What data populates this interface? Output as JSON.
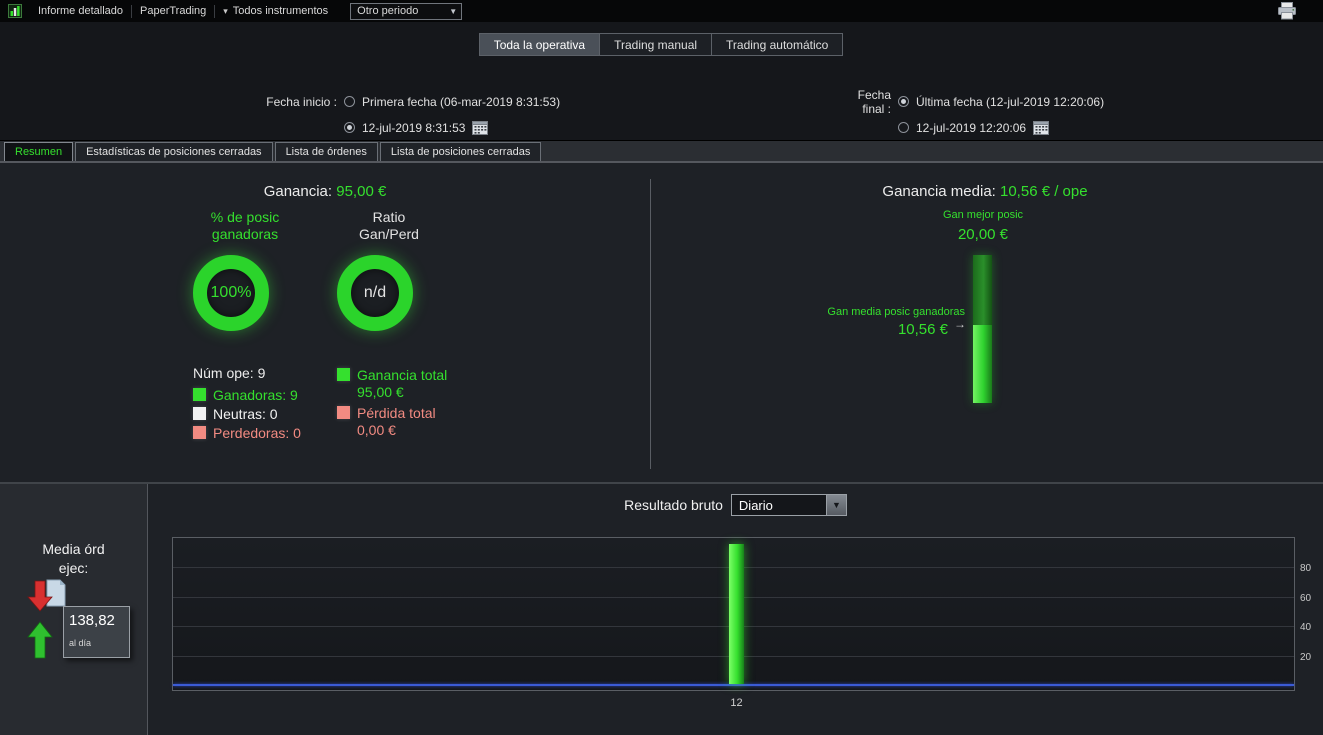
{
  "icons": {
    "caret_down": "▾",
    "dropdown_arrow": "▼",
    "arrow_right": "→"
  },
  "topbar": {
    "title": "Informe detallado",
    "account": "PaperTrading",
    "instruments": "Todos instrumentos",
    "period_select": "Otro periodo"
  },
  "filters": {
    "scope_tabs": [
      "Toda la operativa",
      "Trading manual",
      "Trading automático"
    ],
    "selected_scope": "Toda la operativa",
    "fecha_inicio": {
      "label": "Fecha inicio :",
      "option_first": "Primera fecha (06-mar-2019 8:31:53)",
      "option_custom": "12-jul-2019 8:31:53",
      "selected": "custom"
    },
    "fecha_final": {
      "label": "Fecha final :",
      "option_last": "Última fecha (12-jul-2019 12:20:06)",
      "option_custom": "12-jul-2019 12:20:06",
      "selected": "last"
    }
  },
  "report_tabs": [
    "Resumen",
    "Estadísticas de posiciones cerradas",
    "Lista de órdenes",
    "Lista de posiciones cerradas"
  ],
  "active_report_tab": "Resumen",
  "summary": {
    "ganancia_label": "Ganancia:",
    "ganancia_value": "95,00 €",
    "donut_win": {
      "title": "% de posic\nganadoras",
      "value": "100%"
    },
    "donut_ratio": {
      "title": "Ratio\nGan/Perd",
      "value": "n/d"
    },
    "num_ope": "Núm ope: 9",
    "legend": [
      {
        "label": "Ganadoras: 9",
        "color": "#35e02e"
      },
      {
        "label": "Neutras: 0",
        "color": "#f2f2f2"
      },
      {
        "label": "Perdedoras: 0",
        "color": "#f28b82"
      }
    ],
    "totals": [
      {
        "label": "Ganancia total",
        "value": "95,00 €",
        "color": "#35e02e"
      },
      {
        "label": "Pérdida total",
        "value": "0,00 €",
        "color": "#f28b82"
      }
    ],
    "right": {
      "media_label": "Ganancia media:",
      "media_value": "10,56 € / ope",
      "best_label": "Gan mejor posic",
      "best_value": "20,00 €",
      "avg_label": "Gan media posic ganadoras",
      "avg_value": "10,56 €"
    }
  },
  "bottom": {
    "sidebar": {
      "label": "Media órd\nejec:",
      "value": "138,82",
      "unit": "al día"
    },
    "chart_title": "Resultado bruto",
    "chart_period": "Diario"
  },
  "chart_data": [
    {
      "type": "bar",
      "title": "Resultado bruto",
      "period_option": "Diario",
      "categories": [
        "12"
      ],
      "values": [
        95
      ],
      "ylim": [
        0,
        100
      ],
      "yticks": [
        20,
        40,
        60,
        80
      ],
      "bar_color": "#35e02e",
      "zero_line_color": "#3b5bd6",
      "grid": "horizontal",
      "legend_position": "none"
    },
    {
      "type": "bar",
      "title": "Gan mejor posic",
      "max_value": 20.0,
      "highlight_value": 10.56,
      "max_label": "20,00 €",
      "highlight_label": "10,56 €",
      "bright_color": "#2fd32f",
      "dark_color": "#1c6b1c"
    }
  ]
}
